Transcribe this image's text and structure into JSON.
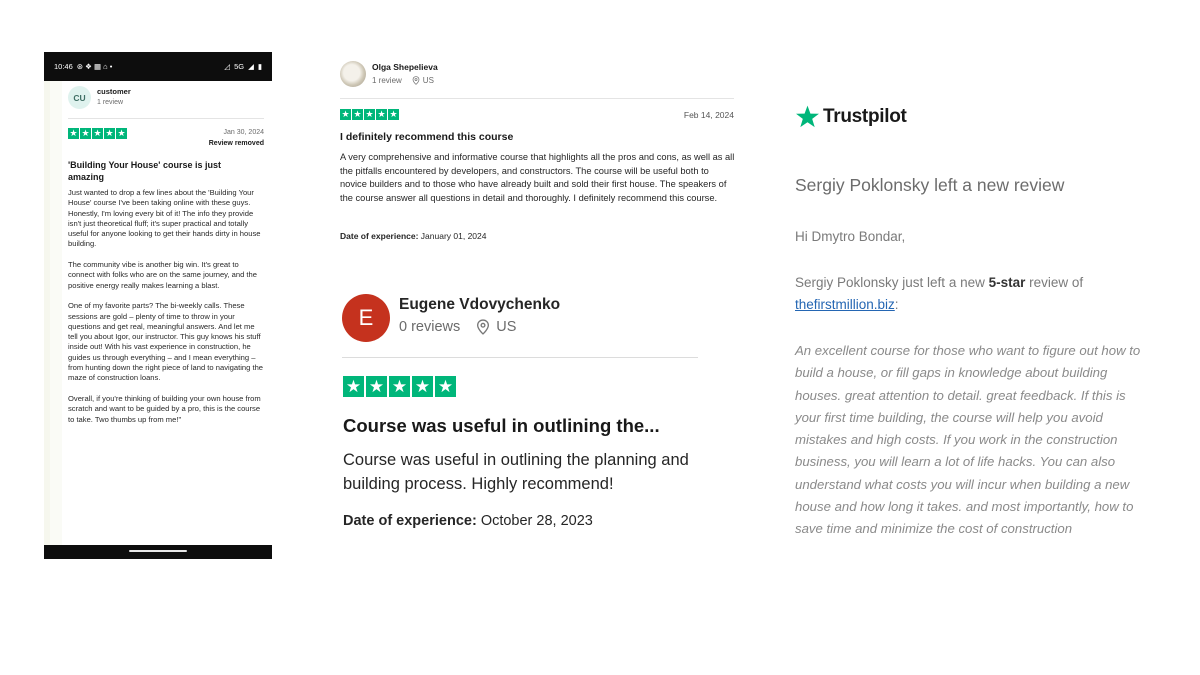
{
  "phone": {
    "status": {
      "time": "10:46",
      "network": "5G"
    },
    "review": {
      "avatar_initials": "CU",
      "name": "customer",
      "count": "1 review",
      "rating": 5,
      "date": "Jan 30, 2024",
      "status": "Review removed",
      "title": "'Building Your House' course is just amazing",
      "paragraphs": [
        "Just wanted to drop a few lines about the 'Building Your House' course I've been taking online with these guys. Honestly, I'm loving every bit of it! The info they provide isn't just theoretical fluff; it's super practical and totally useful for anyone looking to get their hands dirty in house building.",
        "The community vibe is another big win. It's great to connect with folks who are on the same journey, and the positive energy really makes learning a blast.",
        "One of my favorite parts? The bi-weekly calls. These sessions are gold – plenty of time to throw in your questions and get real, meaningful answers. And let me tell you about Igor, our instructor. This guy knows his stuff inside out! With his vast experience in construction, he guides us through everything – and I mean everything – from hunting down the right piece of land to navigating the maze of construction loans.",
        "Overall, if you're thinking of building your own house from scratch and want to be guided by a pro, this is the course to take. Two thumbs up from me!\""
      ]
    }
  },
  "review_olga": {
    "name": "Olga Shepelieva",
    "count": "1 review",
    "country": "US",
    "rating": 5,
    "date": "Feb 14, 2024",
    "title": "I definitely recommend this course",
    "body": "A very comprehensive and informative course that highlights all the pros and cons, as well as all the pitfalls encountered by developers, and constructors. The course will be useful both to novice builders and to those who have already built and sold their first house. The speakers of the course answer all questions in detail and thoroughly. I definitely recommend this course.",
    "exp_label": "Date of experience:",
    "exp_value": "January 01, 2024"
  },
  "review_eugene": {
    "initial": "E",
    "name": "Eugene Vdovychenko",
    "count": "0 reviews",
    "country": "US",
    "rating": 5,
    "title": "Course was useful in outlining the...",
    "body": "Course was useful in outlining the planning and building process. Highly recommend!",
    "exp_label": "Date of experience:",
    "exp_value": "October 28, 2023"
  },
  "trustpilot_email": {
    "brand": "Trustpilot",
    "headline": "Sergiy Poklonsky left a new review",
    "greeting": "Hi Dmytro Bondar,",
    "line_prefix": "Sergiy Poklonsky just left a new",
    "line_bold": "5-star",
    "line_suffix": "review of",
    "link": "thefirstmillion.biz",
    "link_suffix": ":",
    "quote": "An excellent course for those who want to figure out how to build a house, or fill gaps in knowledge about building houses. great attention to detail. great feedback. If this is your first time building, the course will help you avoid mistakes and high costs. If you work in the construction business, you will learn a lot of life hacks. You can also understand what costs you will incur when building a new house and how long it takes. and most importantly, how to save time and minimize the cost of construction"
  },
  "colors": {
    "trustpilot_green": "#00b67a",
    "avatar_red": "#c5321e",
    "link_blue": "#2466b3"
  },
  "icons": [
    "signal-icon",
    "battery-icon",
    "location-pin-icon",
    "star-icon",
    "trustpilot-star-icon"
  ]
}
